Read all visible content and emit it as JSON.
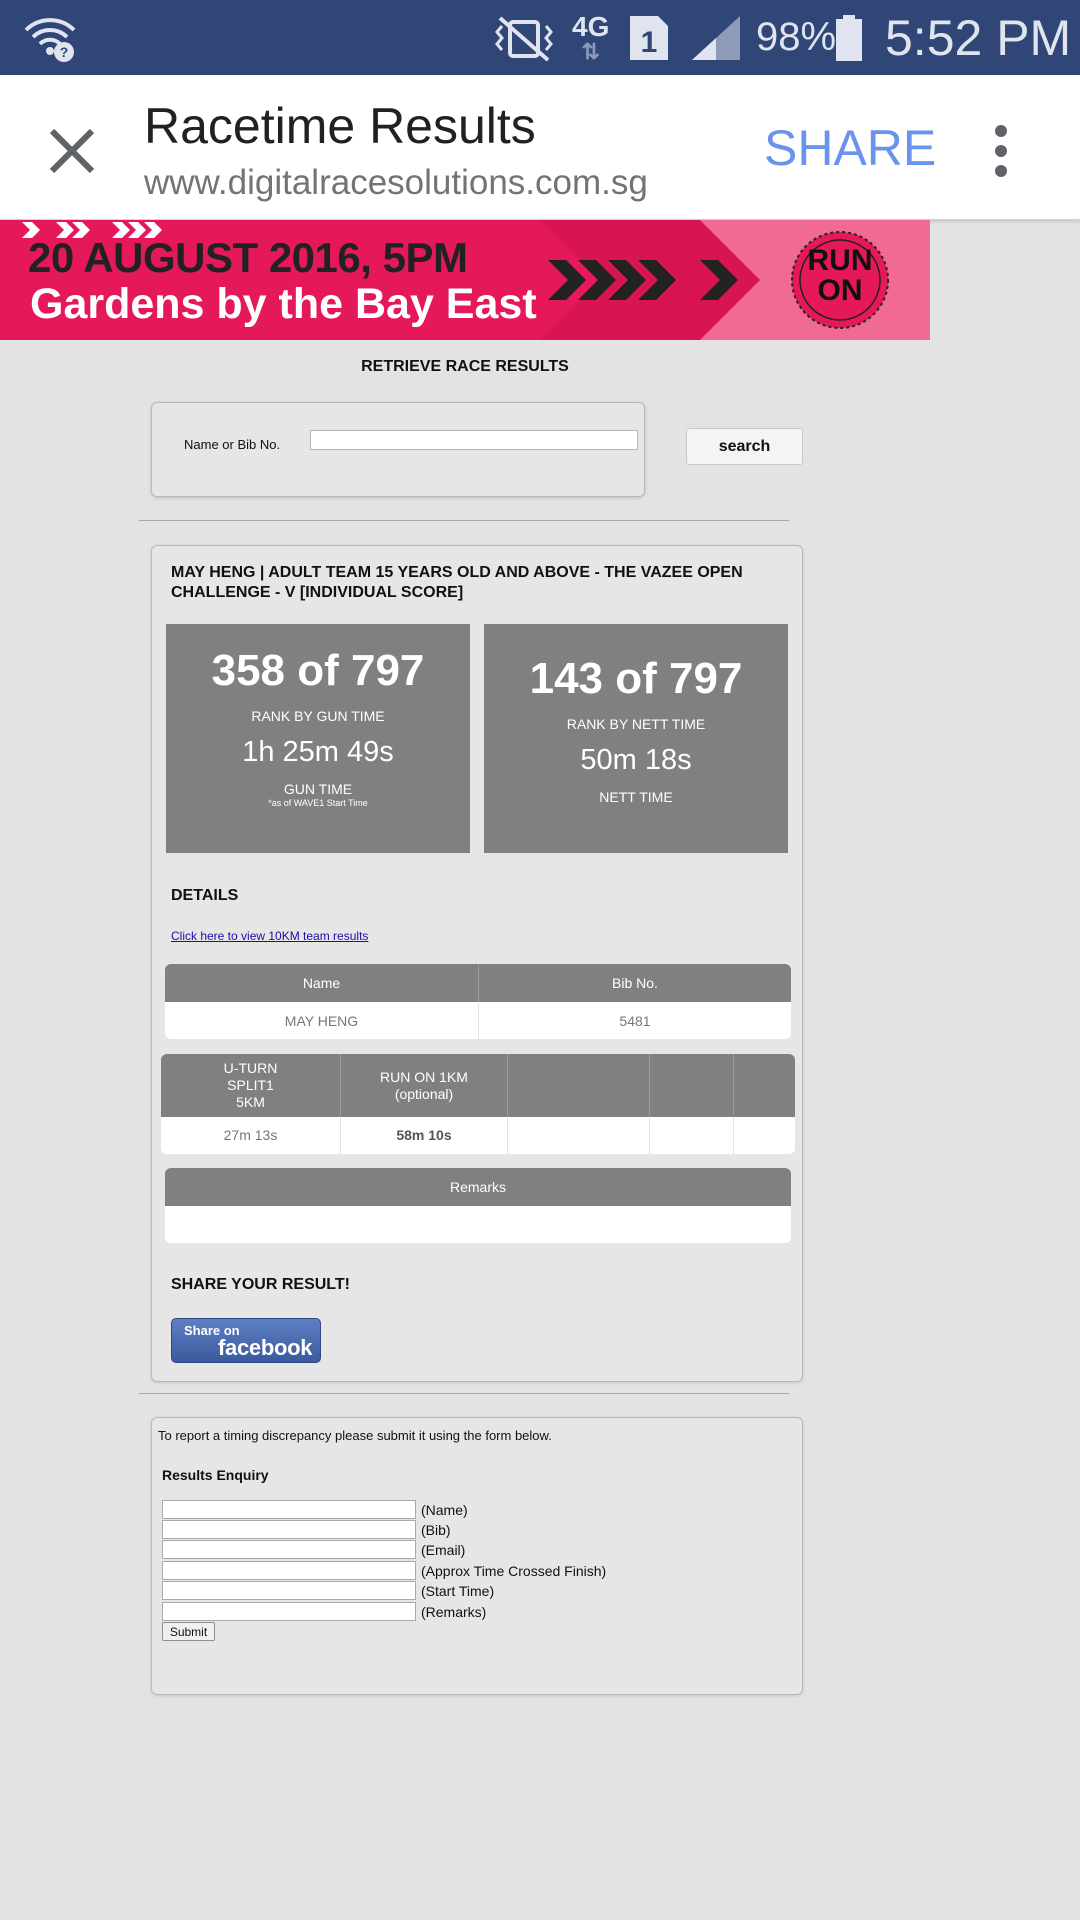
{
  "status_bar": {
    "network": "4G",
    "sim_slot": "1",
    "battery_percent": "98%",
    "time": "5:52 PM",
    "icons": [
      "wifi-question-icon",
      "vibrate-mute-icon",
      "data-arrows-icon",
      "sim-icon",
      "signal-icon",
      "battery-icon"
    ]
  },
  "browser": {
    "title": "Racetime Results",
    "url": "www.digitalracesolutions.com.sg",
    "share_label": "SHARE",
    "accent_color": "#6a93ee"
  },
  "banner": {
    "line1": "20 AUGUST 2016, 5PM",
    "line2": "Gardens by the Bay East",
    "logo_top": "RUN",
    "logo_bottom": "ON",
    "brand_color": "#e5185a"
  },
  "search": {
    "title": "RETRIEVE RACE RESULTS",
    "label": "Name or Bib No.",
    "value": "",
    "button": "search"
  },
  "result": {
    "heading": "MAY HENG | ADULT TEAM 15 YEARS OLD AND ABOVE - THE VAZEE OPEN CHALLENGE - V [INDIVIDUAL SCORE]",
    "gun": {
      "rank": "358 of 797",
      "rank_label": "RANK BY GUN TIME",
      "time": "1h 25m 49s",
      "time_label": "GUN TIME",
      "note": "*as of WAVE1 Start Time"
    },
    "nett": {
      "rank": "143 of 797",
      "rank_label": "RANK BY NETT TIME",
      "time": "50m 18s",
      "time_label": "NETT TIME"
    },
    "details_title": "DETAILS",
    "team_link": "Click here to view 10KM team results",
    "info_table": {
      "headers": [
        "Name",
        "Bib No."
      ],
      "values": [
        "MAY HENG",
        "5481"
      ]
    },
    "split_table": {
      "headers": [
        "U-TURN\nSPLIT1\n5KM",
        "RUN ON 1KM\n(optional)",
        "",
        "",
        ""
      ],
      "values": [
        "27m 13s",
        "58m 10s",
        "",
        "",
        ""
      ]
    },
    "remarks_table": {
      "header": "Remarks",
      "value": ""
    },
    "share_title": "SHARE YOUR RESULT!",
    "facebook": {
      "small": "Share on",
      "big": "facebook"
    }
  },
  "enquiry": {
    "note": "To report a timing discrepancy please submit it using the form below.",
    "title": "Results Enquiry",
    "fields": [
      "(Name)",
      "(Bib)",
      "(Email)",
      "(Approx Time Crossed Finish)",
      "(Start Time)",
      "(Remarks)"
    ],
    "submit": "Submit"
  }
}
